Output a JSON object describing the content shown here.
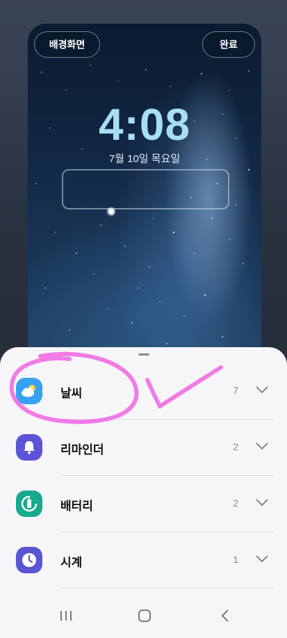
{
  "preview": {
    "wallpaper_button": "배경화면",
    "done_button": "완료",
    "time": "4:08",
    "date": "7월 10일 목요일"
  },
  "sheet": {
    "items": [
      {
        "label": "날씨",
        "count": "7",
        "icon": "weather-icon",
        "color": "#36a3f2"
      },
      {
        "label": "리마인더",
        "count": "2",
        "icon": "bell-icon",
        "color": "#5b54d6"
      },
      {
        "label": "배터리",
        "count": "2",
        "icon": "battery-icon",
        "color": "#16a98c"
      },
      {
        "label": "시계",
        "count": "1",
        "icon": "clock-icon",
        "color": "#5a55d3"
      }
    ]
  },
  "navbar": {
    "recents": "recents-icon",
    "home": "home-icon",
    "back": "back-icon"
  },
  "annotation_color": "#f07be6"
}
